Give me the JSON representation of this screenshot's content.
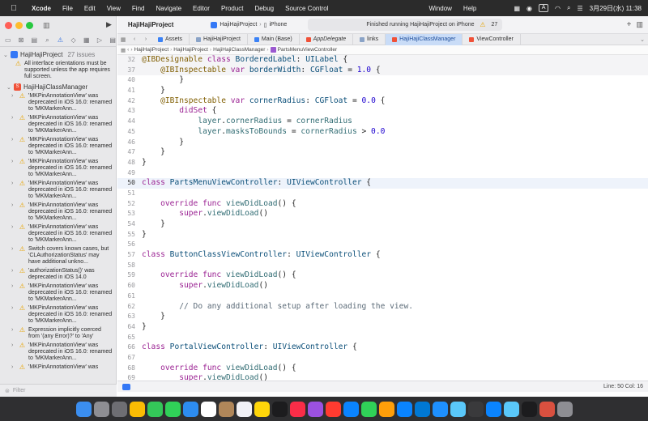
{
  "menubar": {
    "app": "Xcode",
    "items": [
      "File",
      "Edit",
      "View",
      "Find",
      "Navigate",
      "Editor",
      "Product",
      "Debug",
      "Source Control",
      "Window",
      "Help"
    ],
    "input_indicator": "A",
    "clock": "3月29日(水) 11:38"
  },
  "navigator": {
    "project": "HajiHajiProject",
    "issue_count": "27 issues",
    "top_issue": "All interface orientations must be supported unless the app requires full screen.",
    "group": "HajiHajiClassManager",
    "issues": [
      "'MKPinAnnotationView' was deprecated in iOS 16.0: renamed to 'MKMarkerAnn...",
      "'MKPinAnnotationView' was deprecated in iOS 16.0: renamed to 'MKMarkerAnn...",
      "'MKPinAnnotationView' was deprecated in iOS 16.0: renamed to 'MKMarkerAnn...",
      "'MKPinAnnotationView' was deprecated in iOS 16.0: renamed to 'MKMarkerAnn...",
      "'MKPinAnnotationView' was deprecated in iOS 16.0: renamed to 'MKMarkerAnn...",
      "'MKPinAnnotationView' was deprecated in iOS 16.0: renamed to 'MKMarkerAnn...",
      "'MKPinAnnotationView' was deprecated in iOS 16.0: renamed to 'MKMarkerAnn...",
      "Switch covers known cases, but 'CLAuthorizationStatus' may have additional unkno...",
      "'authorizationStatus()' was deprecated in iOS 14.0",
      "'MKPinAnnotationView' was deprecated in iOS 16.0: renamed to 'MKMarkerAnn...",
      "'MKPinAnnotationView' was deprecated in iOS 16.0: renamed to 'MKMarkerAnn...",
      "Expression implicitly coerced from '(any Error)?' to 'Any'",
      "'MKPinAnnotationView' was deprecated in iOS 16.0: renamed to 'MKMarkerAnn...",
      "'MKPinAnnotationView' was"
    ],
    "filter_placeholder": "Filter"
  },
  "toolbar": {
    "project_title": "HajiHajiProject",
    "scheme": "HajiHajiProject",
    "device": "iPhone",
    "status": "Finished running HajiHajiProject on iPhone",
    "warning_count": "27"
  },
  "tabs": [
    "Assets",
    "HajiHajiProject",
    "Main (Base)",
    "AppDelegate",
    "links",
    "HajiHajiClassManager",
    "ViewController"
  ],
  "jumpbar": [
    "HajiHajiProject",
    "HajiHajiProject",
    "HajiHajiClassManager",
    "PartsMenuViewController"
  ],
  "editor_status": "Line: 50  Col: 16",
  "dock_apps": [
    "Finder",
    "Launchpad",
    "Settings",
    "Chrome",
    "Maps",
    "Messages",
    "Mail",
    "Calendar",
    "Contacts",
    "Reminders",
    "Notes",
    "TV",
    "Music",
    "Podcasts",
    "News",
    "Keynote",
    "Numbers",
    "Pages",
    "App Store",
    "VS Code",
    "Xcode",
    "Instruments",
    "Activity",
    "Simulator",
    "Preview",
    "Terminal",
    "Dictionary",
    "Trash"
  ]
}
